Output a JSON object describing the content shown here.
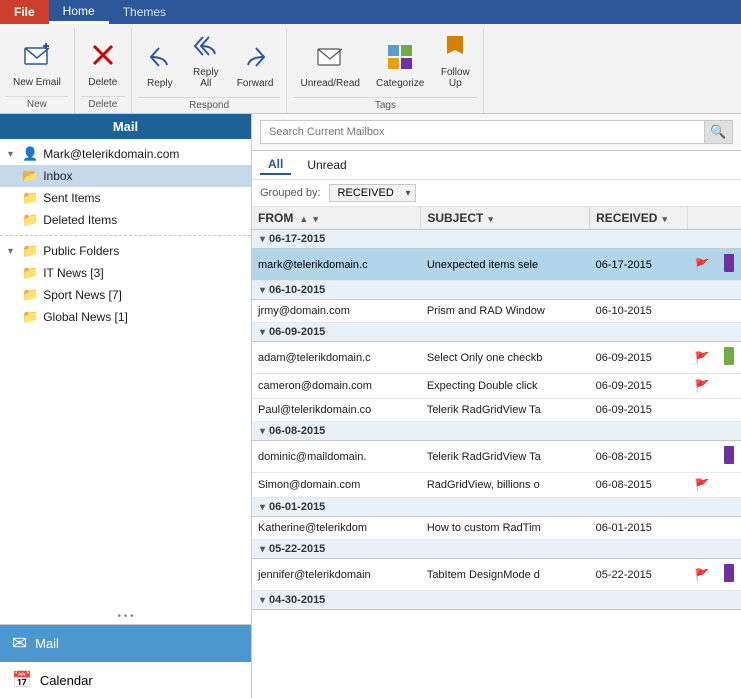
{
  "tabs": [
    {
      "label": "File",
      "id": "file"
    },
    {
      "label": "Home",
      "id": "home",
      "active": true
    },
    {
      "label": "Themes",
      "id": "themes"
    }
  ],
  "ribbon": {
    "groups": [
      {
        "label": "New",
        "buttons": [
          {
            "id": "new-email",
            "icon": "✉",
            "label": "New\nEmail",
            "large": true
          }
        ]
      },
      {
        "label": "Delete",
        "buttons": [
          {
            "id": "delete",
            "icon": "✖",
            "label": "Delete"
          }
        ]
      },
      {
        "label": "Respond",
        "buttons": [
          {
            "id": "reply",
            "icon": "↩",
            "label": "Reply"
          },
          {
            "id": "reply-all",
            "icon": "↩↩",
            "label": "Reply\nAll"
          },
          {
            "id": "forward",
            "icon": "↪",
            "label": "Forward"
          }
        ]
      },
      {
        "label": "Tags",
        "buttons": [
          {
            "id": "unread-read",
            "icon": "📧",
            "label": "Unread/Read"
          },
          {
            "id": "categorize",
            "icon": "⬛",
            "label": "Categorize"
          },
          {
            "id": "follow-up",
            "icon": "🚩",
            "label": "Follow\nUp"
          }
        ]
      }
    ]
  },
  "sidebar": {
    "header": "Mail",
    "tree": {
      "root": "Mark@telerikdomain.com",
      "items": [
        {
          "id": "inbox",
          "label": "Inbox",
          "indent": 1,
          "selected": true
        },
        {
          "id": "sent-items",
          "label": "Sent Items",
          "indent": 1
        },
        {
          "id": "deleted-items",
          "label": "Deleted Items",
          "indent": 1
        },
        {
          "id": "public-folders",
          "label": "Public Folders",
          "indent": 0,
          "expandable": true
        },
        {
          "id": "it-news",
          "label": "IT News [3]",
          "indent": 1
        },
        {
          "id": "sport-news",
          "label": "Sport News [7]",
          "indent": 1
        },
        {
          "id": "global-news",
          "label": "Global News [1]",
          "indent": 1
        }
      ]
    },
    "nav": [
      {
        "id": "mail",
        "icon": "✉",
        "label": "Mail",
        "active": true
      },
      {
        "id": "calendar",
        "icon": "📅",
        "label": "Calendar"
      }
    ]
  },
  "content": {
    "search_placeholder": "Search Current Mailbox",
    "filters": [
      "All",
      "Unread"
    ],
    "active_filter": "All",
    "groupby_label": "Grouped by:",
    "groupby_value": "RECEIVED",
    "columns": [
      {
        "id": "from",
        "label": "FROM",
        "sortable": true,
        "filterable": true
      },
      {
        "id": "subject",
        "label": "SUBJECT",
        "filterable": true
      },
      {
        "id": "received",
        "label": "RECEIVED",
        "filterable": true
      }
    ],
    "groups": [
      {
        "date": "06-17-2015",
        "rows": [
          {
            "from": "mark@telerikdomain.c",
            "subject": "Unexpected items sele",
            "received": "06-17-2015",
            "flag": "🚩",
            "tag": "purple",
            "selected": true
          }
        ]
      },
      {
        "date": "06-10-2015",
        "rows": [
          {
            "from": "jrmy@domain.com",
            "subject": "Prism and RAD Window",
            "received": "06-10-2015",
            "flag": "",
            "tag": ""
          }
        ]
      },
      {
        "date": "06-09-2015",
        "rows": [
          {
            "from": "adam@telerikdomain.c",
            "subject": "Select Only one checkb",
            "received": "06-09-2015",
            "flag": "🚩",
            "tag": "green"
          },
          {
            "from": "cameron@domain.com",
            "subject": "Expecting Double click",
            "received": "06-09-2015",
            "flag": "🚩",
            "tag": ""
          },
          {
            "from": "Paul@telerikdomain.co",
            "subject": "Telerik RadGridView Ta",
            "received": "06-09-2015",
            "flag": "",
            "tag": ""
          }
        ]
      },
      {
        "date": "06-08-2015",
        "rows": [
          {
            "from": "dominic@maildomain.",
            "subject": "Telerik RadGridView Ta",
            "received": "06-08-2015",
            "flag": "",
            "tag": "purple"
          },
          {
            "from": "Simon@domain.com",
            "subject": "RadGridView, billions o",
            "received": "06-08-2015",
            "flag": "🚩",
            "tag": ""
          }
        ]
      },
      {
        "date": "06-01-2015",
        "rows": [
          {
            "from": "Katherine@telerikdom",
            "subject": "How to custom RadTim",
            "received": "06-01-2015",
            "flag": "",
            "tag": ""
          }
        ]
      },
      {
        "date": "05-22-2015",
        "rows": [
          {
            "from": "jennifer@telerikdomain",
            "subject": "TabItem DesignMode d",
            "received": "05-22-2015",
            "flag": "🚩",
            "tag": "purple"
          }
        ]
      },
      {
        "date": "04-30-2015",
        "rows": []
      }
    ]
  }
}
